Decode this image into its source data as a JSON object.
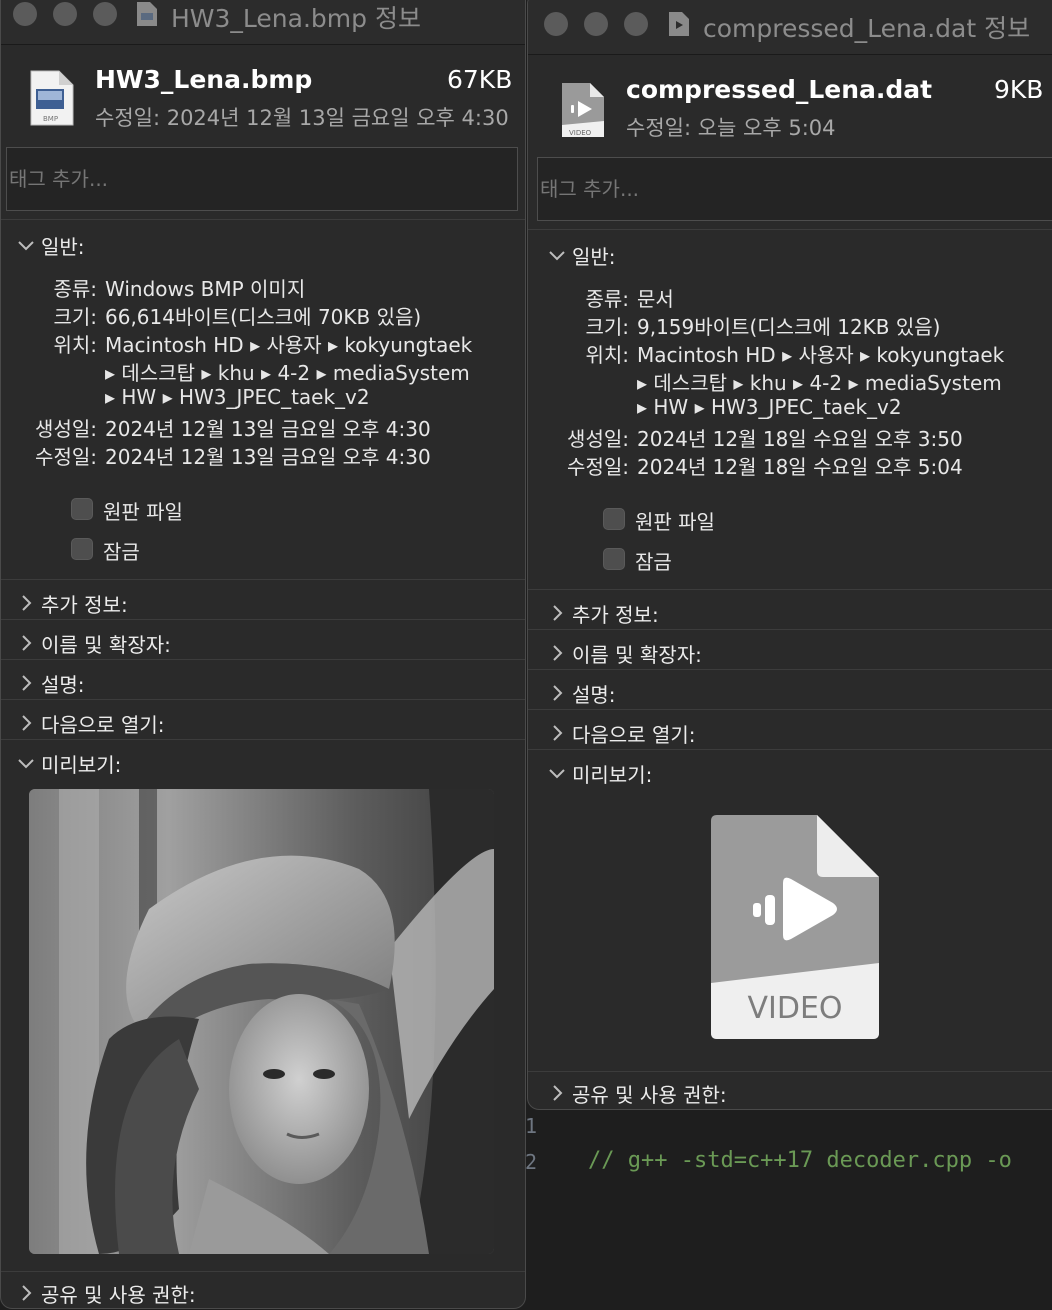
{
  "editor": {
    "line_numbers": [
      "1",
      "2"
    ],
    "line2_comment": "// g++ -std=c++17 decoder.cpp -o"
  },
  "left_window": {
    "title": "HW3_Lena.bmp 정보",
    "icon": "bmp-file-icon",
    "icon_caption": "BMP",
    "file_name": "HW3_Lena.bmp",
    "file_size": "67KB",
    "modified_line": "수정일: 2024년 12월 13일 금요일 오후 4:30",
    "tag_placeholder": "태그 추가...",
    "general_label": "일반:",
    "info": {
      "kind_key": "종류:",
      "kind_val": "Windows BMP 이미지",
      "size_key": "크기:",
      "size_val": "66,614바이트(디스크에 70KB 있음)",
      "where_key": "위치:",
      "where_val_1": "Macintosh HD ▸ 사용자 ▸ kokyungtaek",
      "where_val_2": "▸ 데스크탑 ▸ khu ▸ 4-2 ▸ mediaSystem",
      "where_val_3": "▸ HW ▸ HW3_JPEC_taek_v2",
      "created_key": "생성일:",
      "created_val": "2024년 12월 13일 금요일 오후 4:30",
      "modified_key": "수정일:",
      "modified_val": "2024년 12월 13일 금요일 오후 4:30"
    },
    "stationery_label": "원판 파일",
    "locked_label": "잠금",
    "sections": {
      "more_info": "추가 정보:",
      "name_ext": "이름 및 확장자:",
      "comments": "설명:",
      "open_with": "다음으로 열기:",
      "preview": "미리보기:",
      "sharing": "공유 및 사용 권한:"
    }
  },
  "right_window": {
    "title": "compressed_Lena.dat 정보",
    "icon": "video-file-icon",
    "icon_caption": "VIDEO",
    "file_name": "compressed_Lena.dat",
    "file_size": "9KB",
    "modified_line": "수정일: 오늘 오후 5:04",
    "tag_placeholder": "태그 추가...",
    "general_label": "일반:",
    "info": {
      "kind_key": "종류:",
      "kind_val": "문서",
      "size_key": "크기:",
      "size_val": "9,159바이트(디스크에 12KB 있음)",
      "where_key": "위치:",
      "where_val_1": "Macintosh HD ▸ 사용자 ▸ kokyungtaek",
      "where_val_2": "▸ 데스크탑 ▸ khu ▸ 4-2 ▸ mediaSystem",
      "where_val_3": "▸ HW ▸ HW3_JPEC_taek_v2",
      "created_key": "생성일:",
      "created_val": "2024년 12월 18일 수요일 오후 3:50",
      "modified_key": "수정일:",
      "modified_val": "2024년 12월 18일 수요일 오후 5:04"
    },
    "stationery_label": "원판 파일",
    "locked_label": "잠금",
    "sections": {
      "more_info": "추가 정보:",
      "name_ext": "이름 및 확장자:",
      "comments": "설명:",
      "open_with": "다음으로 열기:",
      "preview": "미리보기:",
      "sharing": "공유 및 사용 권한:"
    },
    "preview_caption": "VIDEO"
  },
  "colors": {
    "window_bg": "#2a2a2a",
    "separator": "#3c3c3c",
    "comment_green": "#6a9955"
  }
}
